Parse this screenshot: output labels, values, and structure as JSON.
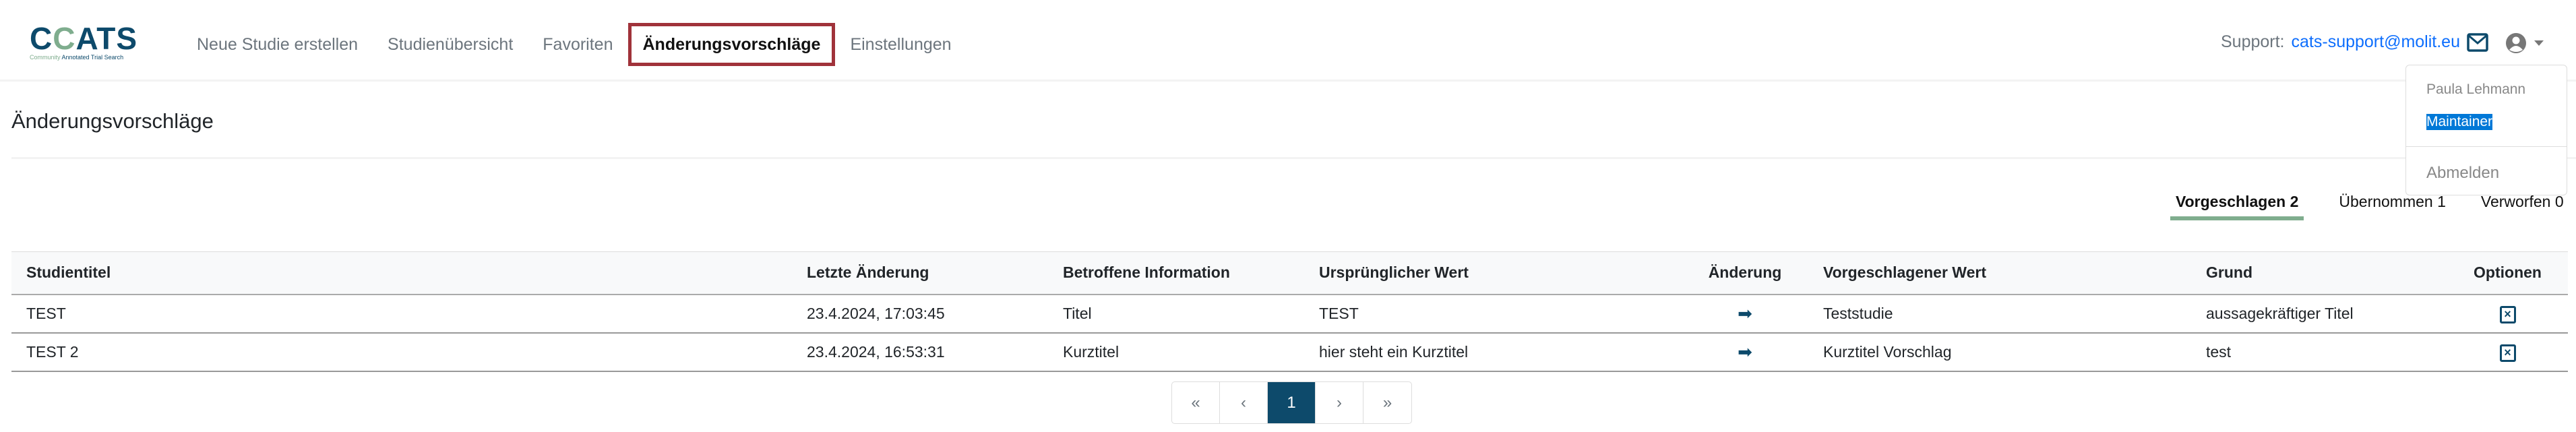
{
  "logo": {
    "name": "CATS",
    "tagline_1": "Community",
    "tagline_2": "Annotated Trial Search"
  },
  "nav": {
    "items": [
      {
        "label": "Neue Studie erstellen",
        "active": false
      },
      {
        "label": "Studienübersicht",
        "active": false
      },
      {
        "label": "Favoriten",
        "active": false
      },
      {
        "label": "Änderungsvorschläge",
        "active": true
      },
      {
        "label": "Einstellungen",
        "active": false
      }
    ]
  },
  "support": {
    "label": "Support:",
    "email": "cats-support@molit.eu",
    "icon": "mail-icon"
  },
  "user_menu": {
    "icon": "user-circle-icon",
    "name": "Paula Lehmann",
    "role": "Maintainer",
    "logout": "Abmelden"
  },
  "page": {
    "title": "Änderungsvorschläge"
  },
  "tabs": [
    {
      "label": "Vorgeschlagen 2",
      "active": true
    },
    {
      "label": "Übernommen 1",
      "active": false
    },
    {
      "label": "Verworfen 0",
      "active": false
    }
  ],
  "table": {
    "headers": [
      "Studientitel",
      "Letzte Änderung",
      "Betroffene Information",
      "Ursprünglicher Wert",
      "Änderung",
      "Vorgeschlagener Wert",
      "Grund",
      "Optionen"
    ],
    "rows": [
      [
        "TEST",
        "23.4.2024, 17:03:45",
        "Titel",
        "TEST",
        "Teststudie",
        "aussagekräftiger Titel"
      ],
      [
        "TEST 2",
        "23.4.2024, 16:53:31",
        "Kurztitel",
        "hier steht ein Kurztitel",
        "Kurztitel Vorschlag",
        "test"
      ]
    ]
  },
  "pagination": {
    "first": "«",
    "prev": "‹",
    "current": "1",
    "next": "›",
    "last": "»"
  },
  "colors": {
    "brand": "#0d4a6b",
    "accent_green": "#7fad8e",
    "active_nav_border": "#a0323a",
    "selection": "#0078d7"
  }
}
